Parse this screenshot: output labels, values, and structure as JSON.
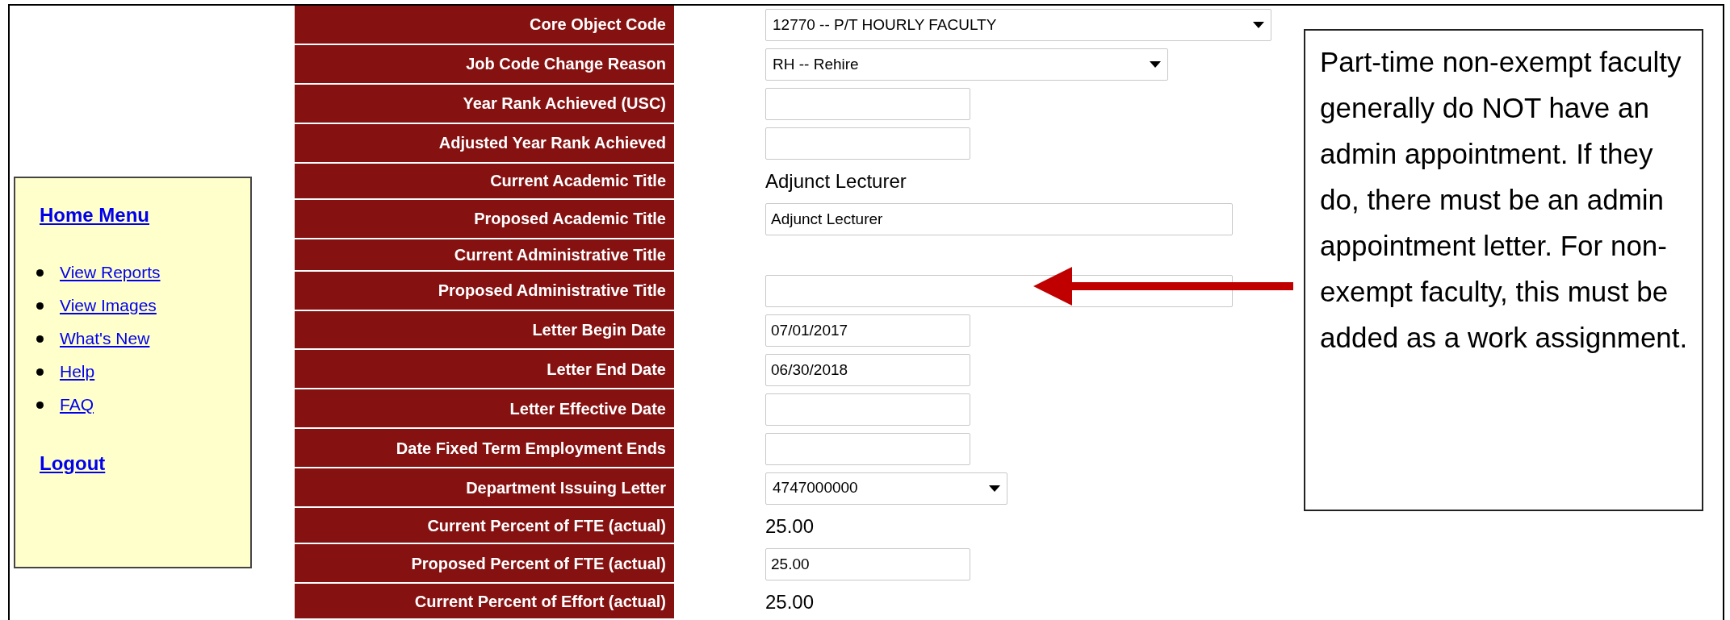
{
  "sidebar": {
    "title": "Home Menu",
    "items": [
      {
        "label": "View Reports"
      },
      {
        "label": "View Images"
      },
      {
        "label": "What's New"
      },
      {
        "label": "Help"
      },
      {
        "label": "FAQ"
      }
    ],
    "logout": "Logout"
  },
  "form": {
    "rows": [
      {
        "label": "Core Object Code",
        "kind": "select",
        "value": "12770 -- P/T HOURLY FACULTY"
      },
      {
        "label": "Job Code Change Reason",
        "kind": "select",
        "value": "RH -- Rehire"
      },
      {
        "label": "Year Rank Achieved (USC)",
        "kind": "input"
      },
      {
        "label": "Adjusted Year Rank Achieved",
        "kind": "input"
      },
      {
        "label": "Current Academic Title",
        "kind": "text",
        "value": "Adjunct Lecturer"
      },
      {
        "label": "Proposed Academic Title",
        "kind": "input",
        "value": "Adjunct Lecturer"
      },
      {
        "label": "Current Administrative Title",
        "kind": "none"
      },
      {
        "label": "Proposed Administrative Title",
        "kind": "input"
      },
      {
        "label": "Letter Begin Date",
        "kind": "input",
        "value": "07/01/2017"
      },
      {
        "label": "Letter End Date",
        "kind": "input",
        "value": "06/30/2018"
      },
      {
        "label": "Letter Effective Date",
        "kind": "input"
      },
      {
        "label": "Date Fixed Term Employment Ends",
        "kind": "input"
      },
      {
        "label": "Department Issuing Letter",
        "kind": "select",
        "value": "4747000000"
      },
      {
        "label": "Current Percent of FTE (actual)",
        "kind": "text",
        "value": "25.00"
      },
      {
        "label": "Proposed Percent of FTE (actual)",
        "kind": "input",
        "value": "25.00"
      },
      {
        "label": "Current Percent of Effort (actual)",
        "kind": "text",
        "value": "25.00"
      }
    ]
  },
  "callout": {
    "text": "Part-time non-exempt faculty generally do NOT have an admin appointment. If they do, there must be an admin appointment letter. For non-exempt faculty, this must be added as a work assignment."
  }
}
